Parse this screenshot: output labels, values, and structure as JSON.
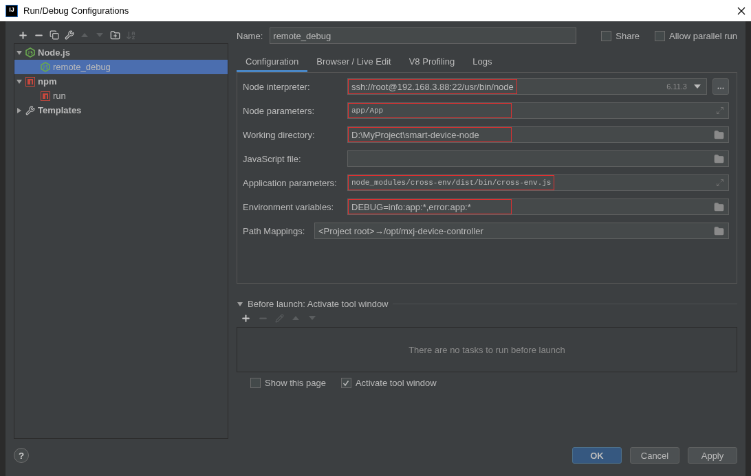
{
  "window": {
    "title": "Run/Debug Configurations",
    "logo": "IJ"
  },
  "toolbar": [
    {
      "kind": "add",
      "disabled": false
    },
    {
      "kind": "remove",
      "disabled": false
    },
    {
      "kind": "copy",
      "disabled": false
    },
    {
      "kind": "wrench",
      "disabled": false
    },
    {
      "kind": "up",
      "disabled": true
    },
    {
      "kind": "down",
      "disabled": true
    },
    {
      "kind": "folder",
      "disabled": false
    },
    {
      "kind": "sort",
      "disabled": true
    }
  ],
  "tree": [
    {
      "label": "Node.js",
      "kind": "node",
      "expanded": true,
      "selected": false,
      "children": [
        {
          "label": "remote_debug",
          "kind": "node",
          "selected": true
        }
      ]
    },
    {
      "label": "npm",
      "kind": "npm",
      "expanded": true,
      "selected": false,
      "children": [
        {
          "label": "run",
          "kind": "npm",
          "selected": false
        }
      ]
    },
    {
      "label": "Templates",
      "kind": "wrench",
      "expanded": false,
      "selected": false
    }
  ],
  "name": {
    "label": "Name:",
    "value": "remote_debug"
  },
  "options": [
    {
      "label": "Share",
      "checked": false
    },
    {
      "label": "Allow parallel run",
      "checked": false
    }
  ],
  "tabs": [
    {
      "label": "Configuration",
      "selected": true
    },
    {
      "label": "Browser / Live Edit",
      "selected": false
    },
    {
      "label": "V8 Profiling",
      "selected": false
    },
    {
      "label": "Logs",
      "selected": false
    }
  ],
  "fields": [
    {
      "label": "Node interpreter:",
      "value": "ssh://root@192.168.3.88:22/usr/bin/node",
      "version": "6.11.3",
      "kind": "dropdown",
      "highlighted": true
    },
    {
      "label": "Node parameters:",
      "value": "app/App",
      "kind": "expand",
      "mono": true,
      "highlighted": true
    },
    {
      "label": "Working directory:",
      "value": "D:\\MyProject\\smart-device-node",
      "kind": "folder",
      "highlighted": true
    },
    {
      "label": "JavaScript file:",
      "kind": "folder"
    },
    {
      "label": "Application parameters:",
      "value": "node_modules/cross-env/dist/bin/cross-env.js",
      "kind": "expand",
      "mono": true,
      "highlighted": true
    },
    {
      "label": "Environment variables:",
      "value": "DEBUG=info:app:*,error:app:*",
      "kind": "folder",
      "highlighted": true
    },
    {
      "label": "Path Mappings:",
      "value": "<Project root>→/opt/mxj-device-controller",
      "kind": "mappings",
      "highlighted": false
    }
  ],
  "before_launch": {
    "title": "Before launch: Activate tool window",
    "expanded": true,
    "tools": [
      {
        "kind": "add",
        "disabled": false
      },
      {
        "kind": "remove",
        "disabled": true
      },
      {
        "kind": "edit",
        "disabled": true
      },
      {
        "kind": "up",
        "disabled": true
      },
      {
        "kind": "down",
        "disabled": true
      }
    ],
    "empty_text": "There are no tasks to run before launch"
  },
  "launch_options": [
    {
      "label": "Show this page",
      "checked": false
    },
    {
      "label": "Activate tool window",
      "checked": true
    }
  ],
  "help": "?",
  "buttons": [
    {
      "label": "OK",
      "kind": "primary"
    },
    {
      "label": "Cancel",
      "kind": "normal"
    },
    {
      "label": "Apply",
      "kind": "normal"
    }
  ]
}
